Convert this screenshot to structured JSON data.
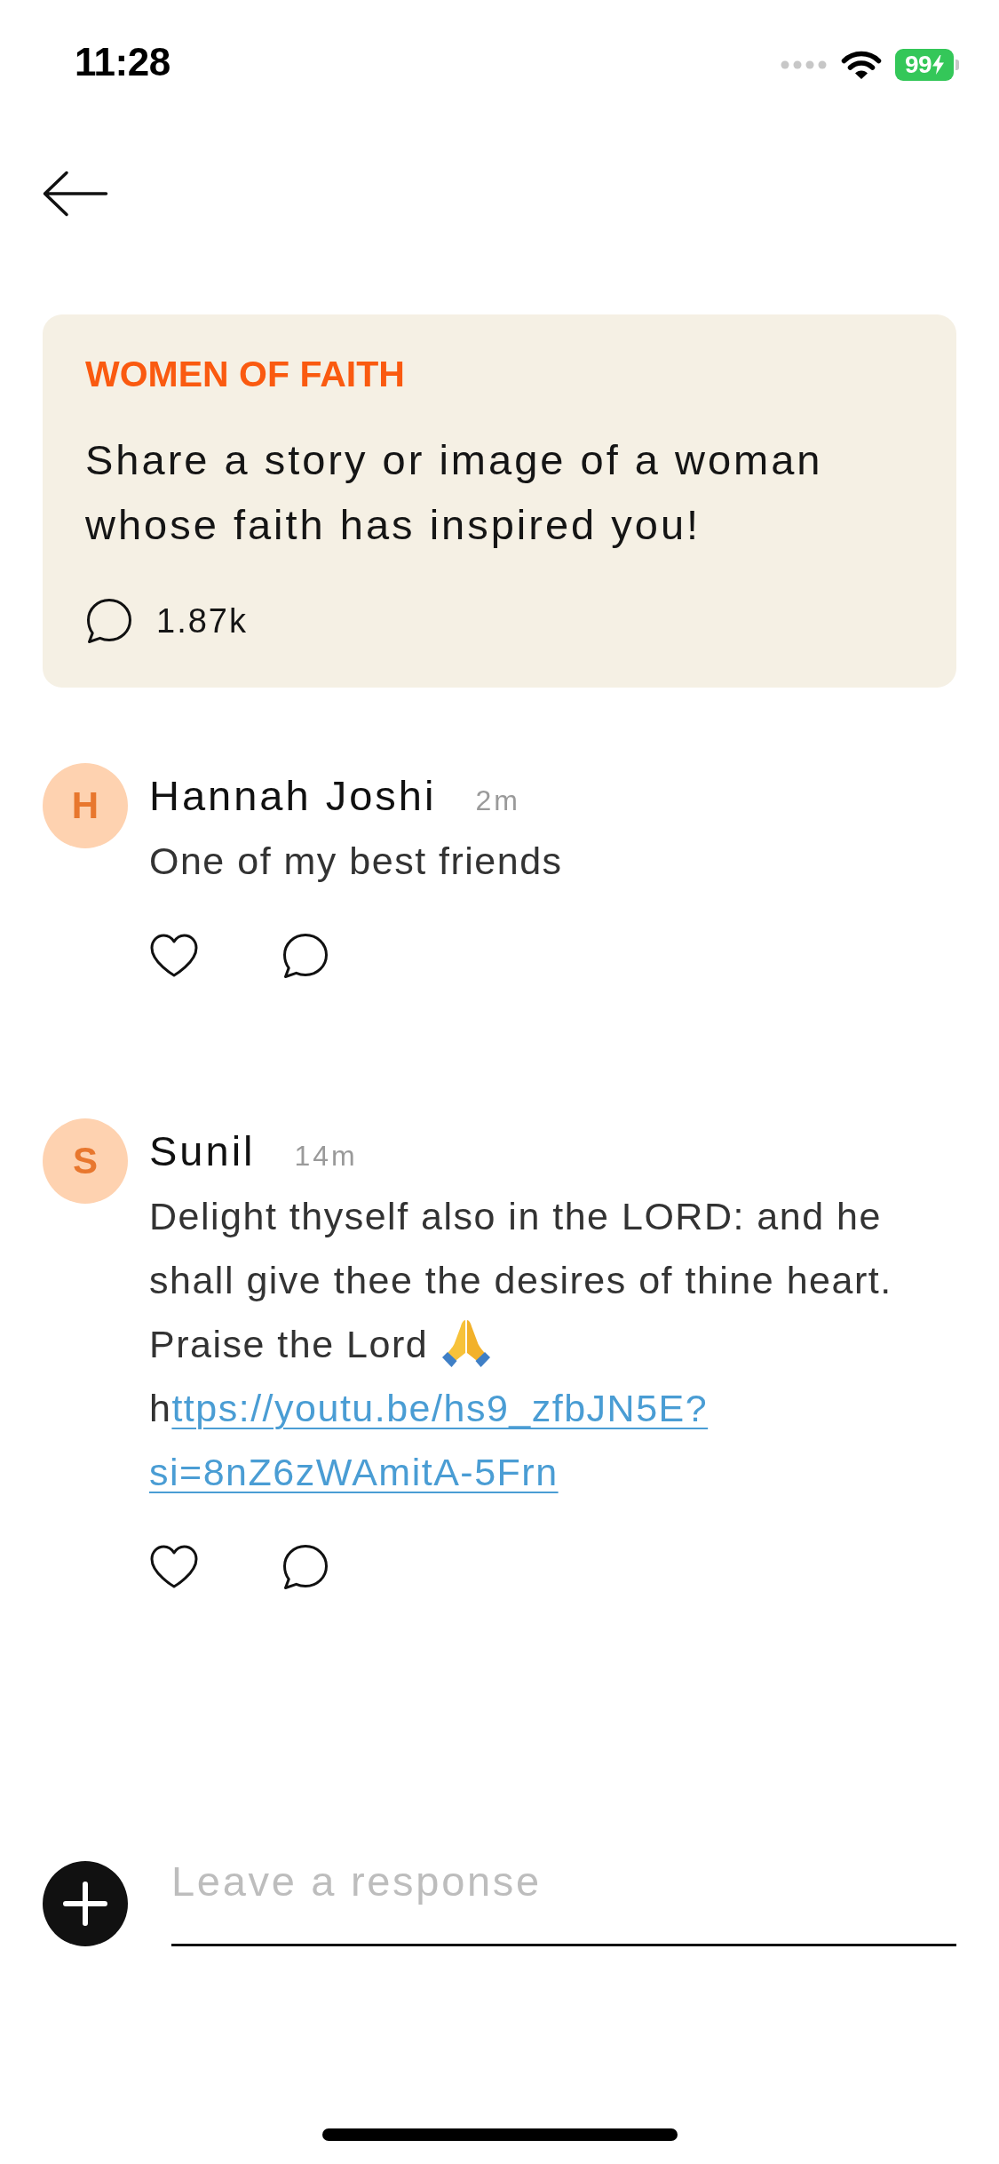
{
  "status_bar": {
    "time": "11:28",
    "battery": "99"
  },
  "prompt": {
    "category": "WOMEN OF FAITH",
    "text": "Share a story or image of a woman whose faith has inspired you!",
    "responses": "1.87k"
  },
  "comments": [
    {
      "initial": "H",
      "author": "Hannah Joshi",
      "time": "2m",
      "text": "One of my best friends",
      "emoji_after_text": false,
      "liked": false
    },
    {
      "initial": "S",
      "author": "Sunil",
      "time": "14m",
      "text": "Delight thyself also in the LORD: and he shall give thee the desires of thine heart. Praise the Lord",
      "emoji_after_text": true,
      "link": {
        "prefix": "h",
        "lines": [
          "ttps://youtu.be/hs9_zfbJN5E?",
          "si=8nZ6zWAmitA-5Frn"
        ]
      },
      "liked": false
    }
  ],
  "composer": {
    "placeholder": "Leave a response"
  }
}
